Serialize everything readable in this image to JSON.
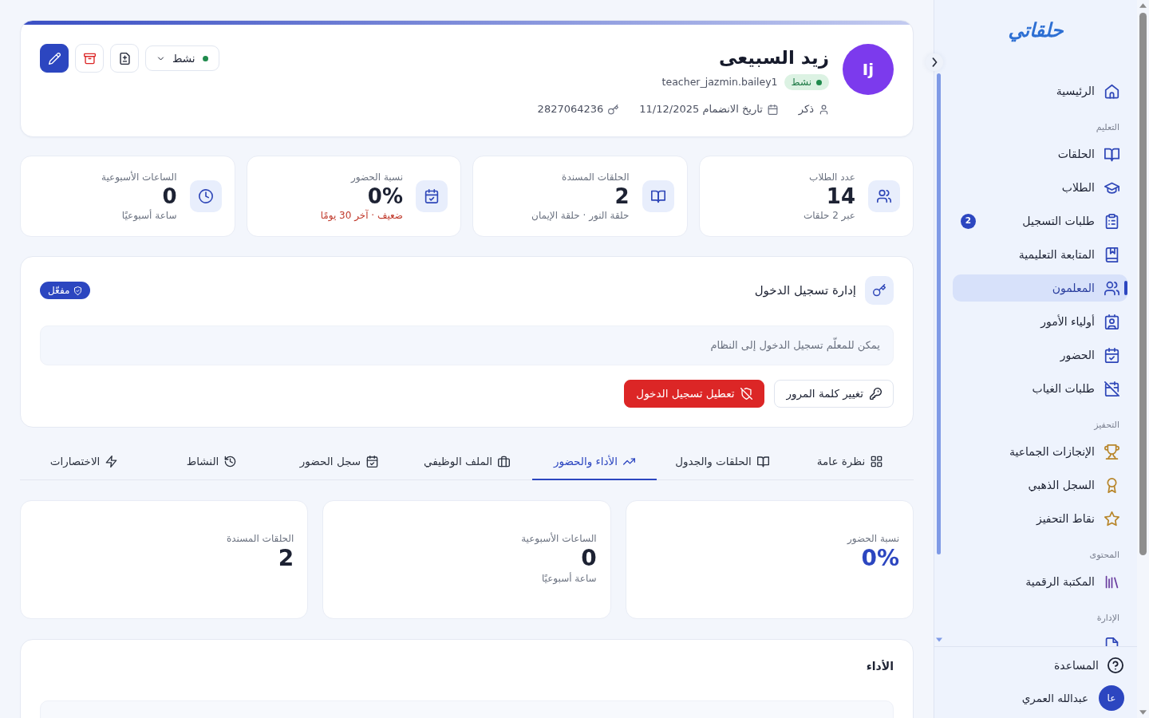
{
  "sidebar": {
    "logo": "حلقاتي",
    "nav": [
      {
        "kind": "link",
        "label": "الرئيسية",
        "selected": false
      },
      {
        "kind": "section",
        "label": "التعليم"
      },
      {
        "kind": "link",
        "label": "الحلقات",
        "selected": false
      },
      {
        "kind": "link",
        "label": "الطلاب",
        "selected": false
      },
      {
        "kind": "link",
        "label": "طلبات التسجيل",
        "selected": false,
        "badge": "2"
      },
      {
        "kind": "link",
        "label": "المتابعة التعليمية",
        "selected": false
      },
      {
        "kind": "link",
        "label": "المعلمون",
        "selected": true
      },
      {
        "kind": "link",
        "label": "أولياء الأمور",
        "selected": false
      },
      {
        "kind": "link",
        "label": "الحضور",
        "selected": false
      },
      {
        "kind": "link",
        "label": "طلبات الغياب",
        "selected": false
      },
      {
        "kind": "section",
        "label": "التحفيز"
      },
      {
        "kind": "link",
        "label": "الإنجازات الجماعية",
        "selected": false
      },
      {
        "kind": "link",
        "label": "السجل الذهبي",
        "selected": false
      },
      {
        "kind": "link",
        "label": "نقاط التحفيز",
        "selected": false
      },
      {
        "kind": "section",
        "label": "المحتوى"
      },
      {
        "kind": "link",
        "label": "المكتبة الرقمية",
        "selected": false
      },
      {
        "kind": "section",
        "label": "الإدارة"
      },
      {
        "kind": "link",
        "selected": false
      }
    ],
    "help": "المساعدة",
    "user": {
      "initials": "عا",
      "name": "عبدالله العمري"
    }
  },
  "profile": {
    "initials": "Ij",
    "name": "زيد السبيعى",
    "status": "نشط",
    "username": "teacher_jazmin.bailey1",
    "meta": [
      "ذكر",
      "تاريخ الانضمام 11/12/2025",
      "2827064236"
    ],
    "status_select": "نشط"
  },
  "stats": [
    {
      "label": "عدد الطلاب",
      "value": "14",
      "note": "عبر 2 حلقات",
      "alert": false
    },
    {
      "label": "الحلقات المسندة",
      "value": "2",
      "note": "حلقة النور · حلقة الإيمان",
      "alert": false
    },
    {
      "label": "نسبة الحضور",
      "value": "0%",
      "note": "ضعيف · آخر 30 يومًا",
      "alert": true
    },
    {
      "label": "الساعات الأسبوعية",
      "value": "0",
      "note": "ساعة أسبوعيًا",
      "alert": false
    }
  ],
  "login": {
    "title": "إدارة تسجيل الدخول",
    "status": "مفعّل",
    "message": "يمكن للمعلّم تسجيل الدخول إلى النظام",
    "buttons": [
      {
        "label": "تغيير كلمة المرور",
        "kind": "outline"
      },
      {
        "label": "تعطيل تسجيل الدخول",
        "kind": "danger"
      }
    ]
  },
  "tabs": [
    {
      "label": "نظرة عامة",
      "selected": false
    },
    {
      "label": "الحلقات والجدول",
      "selected": false
    },
    {
      "label": "الأداء والحضور",
      "selected": true
    },
    {
      "label": "الملف الوظيفي",
      "selected": false
    },
    {
      "label": "سجل الحضور",
      "selected": false
    },
    {
      "label": "النشاط",
      "selected": false
    },
    {
      "label": "الاختصارات",
      "selected": false
    }
  ],
  "summary": [
    {
      "label": "نسبة الحضور",
      "value": "0%",
      "accent": true
    },
    {
      "label": "الساعات الأسبوعية",
      "value": "0",
      "note": "ساعة أسبوعيًا",
      "accent": false
    },
    {
      "label": "الحلقات المسندة",
      "value": "2",
      "accent": false
    }
  ],
  "performance": {
    "title": "الأداء"
  }
}
